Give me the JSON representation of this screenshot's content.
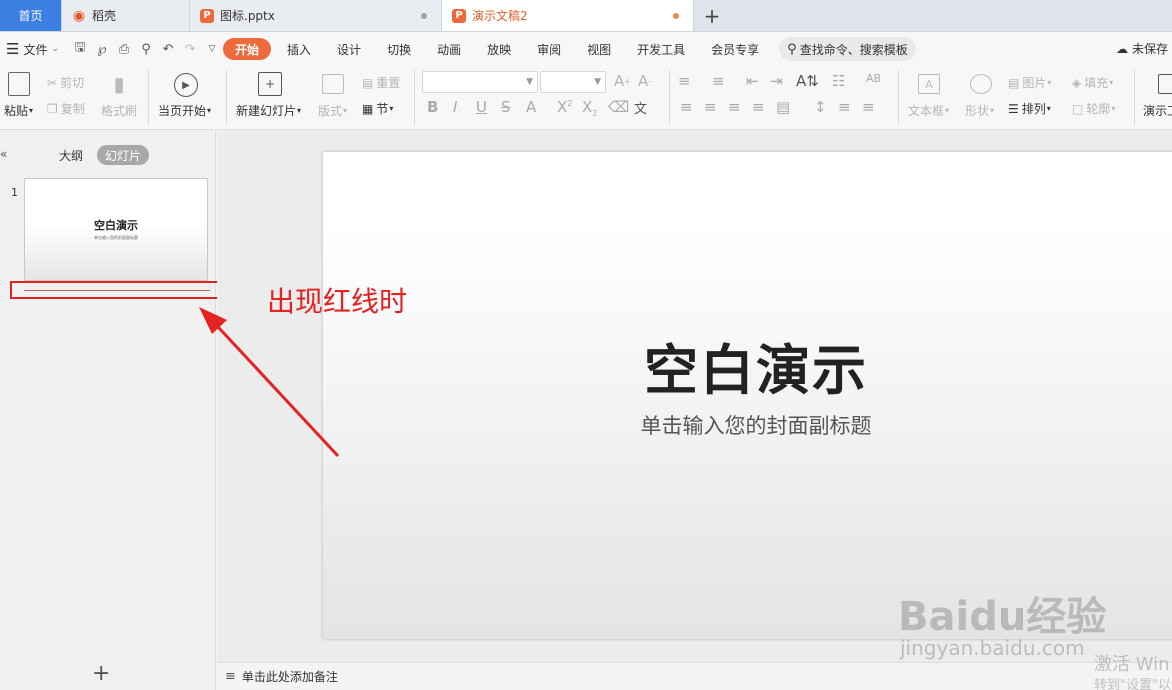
{
  "tabs": {
    "home": "首页",
    "daoke": "稻壳",
    "file1": "图标.pptx",
    "active": "演示文稿2",
    "new_tab": "+"
  },
  "menu": {
    "file": "文件",
    "tabs": [
      "开始",
      "插入",
      "设计",
      "切换",
      "动画",
      "放映",
      "审阅",
      "视图",
      "开发工具",
      "会员专享"
    ],
    "search": "查找命令、搜索模板",
    "unsaved": "未保存"
  },
  "ribbon": {
    "paste": "粘贴",
    "cut": "剪切",
    "copy": "复制",
    "format_painter": "格式刷",
    "from_current": "当页开始",
    "new_slide": "新建幻灯片",
    "layout": "版式",
    "reset": "重置",
    "section": "节",
    "text_box": "文本框",
    "shape": "形状",
    "picture": "图片",
    "fill": "填充",
    "arrange": "排列",
    "outline": "轮廓",
    "present": "演示工"
  },
  "left_panel": {
    "outline_tab": "大纲",
    "slides_tab": "幻灯片",
    "slide_number": "1",
    "thumb_title": "空白演示",
    "thumb_subtitle": "单击输入您的封面副标题",
    "add": "+"
  },
  "annotation": {
    "text": "出现红线时",
    "color": "#e52222"
  },
  "slide": {
    "title": "空白演示",
    "subtitle": "单击输入您的封面副标题"
  },
  "notes": {
    "placeholder": "单击此处添加备注"
  },
  "watermarks": {
    "baidu": "Baidu经验",
    "jingyan": "jingyan.baidu.com",
    "activate1": "激活 Win",
    "activate2": "转到\"设置\"以"
  },
  "colors": {
    "accent": "#ec6a3b",
    "home_tab": "#3b7fe0",
    "annotation_red": "#e02020"
  }
}
